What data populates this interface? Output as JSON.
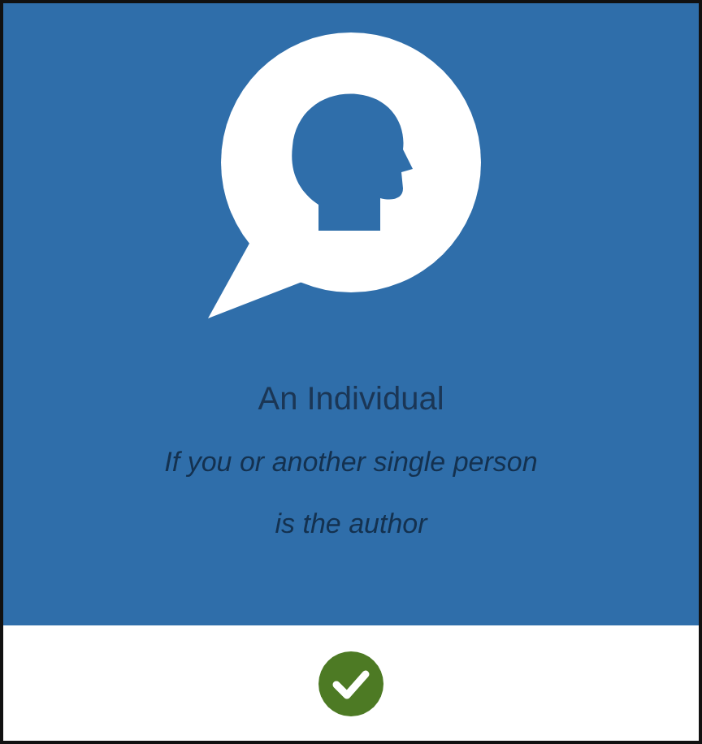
{
  "card": {
    "title": "An Individual",
    "subtitle": "If you or another single person is the author",
    "selected": true
  }
}
